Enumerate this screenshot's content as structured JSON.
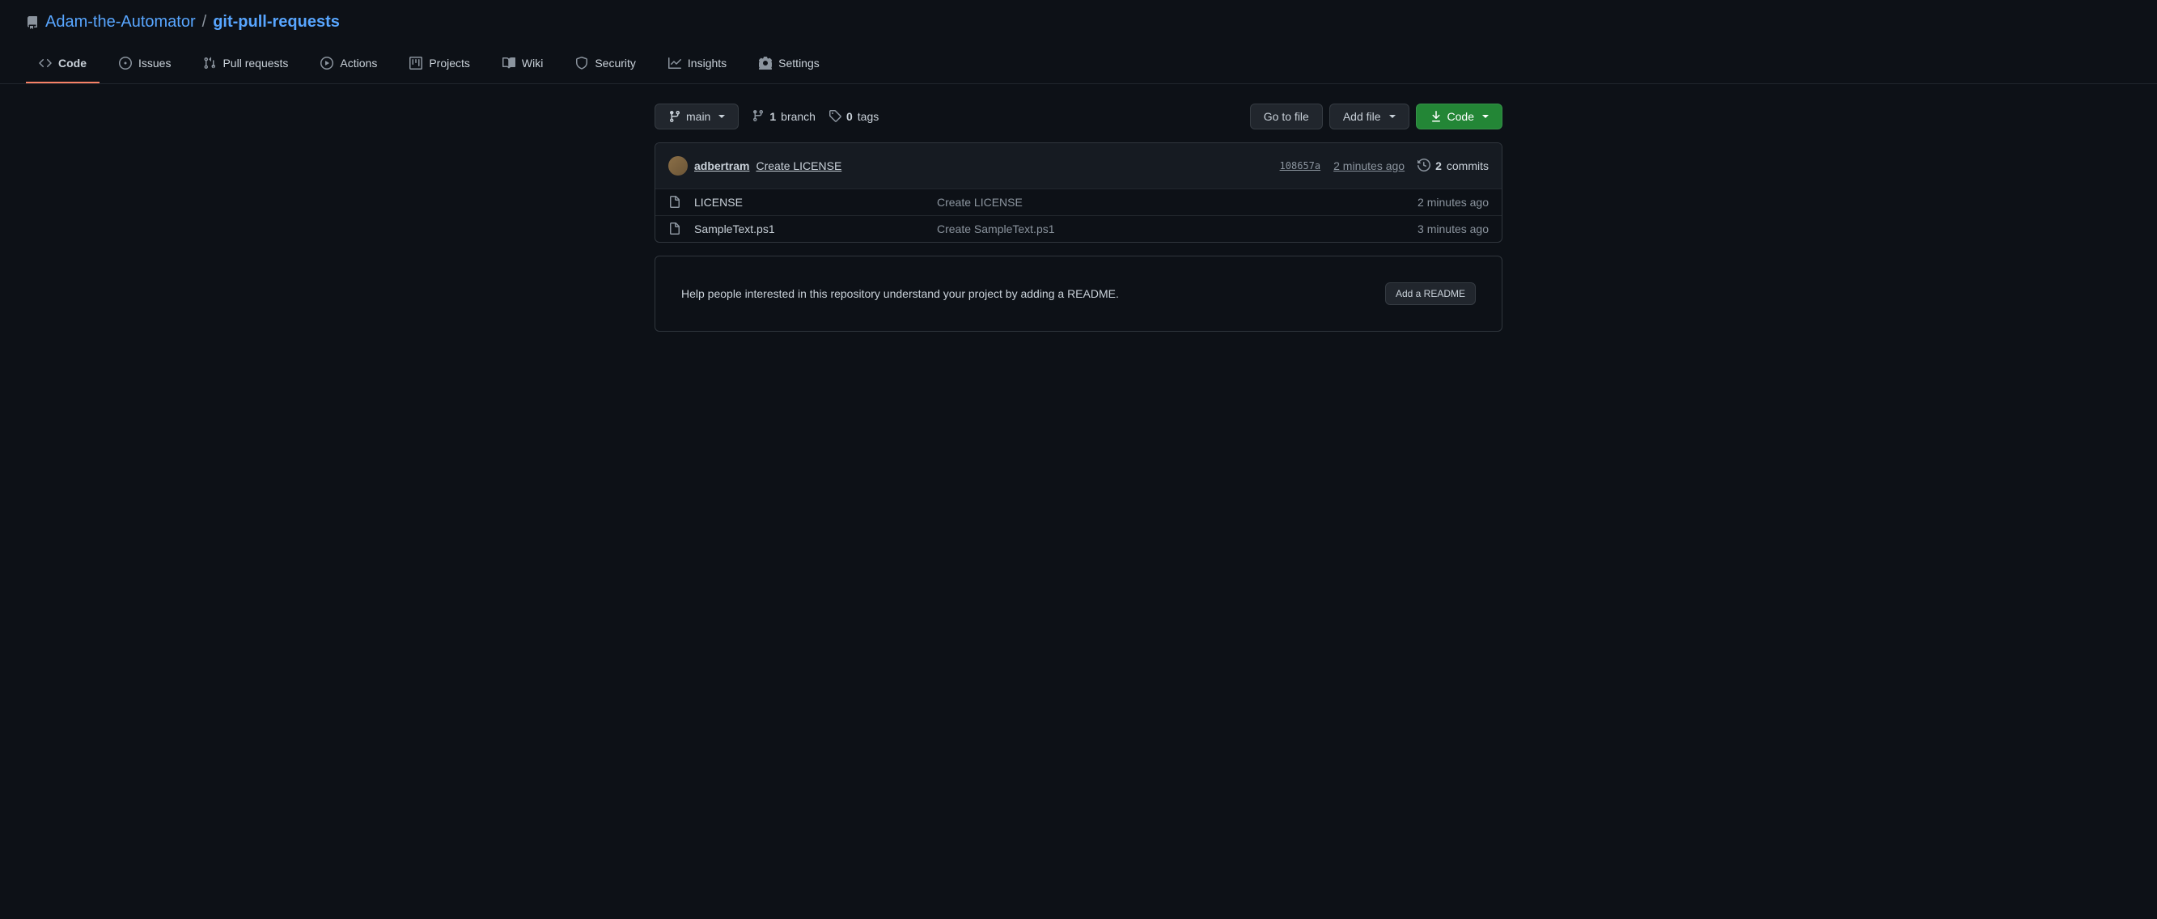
{
  "breadcrumb": {
    "owner": "Adam-the-Automator",
    "repo": "git-pull-requests"
  },
  "tabs": {
    "code": "Code",
    "issues": "Issues",
    "pull_requests": "Pull requests",
    "actions": "Actions",
    "projects": "Projects",
    "wiki": "Wiki",
    "security": "Security",
    "insights": "Insights",
    "settings": "Settings"
  },
  "toolbar": {
    "branch_name": "main",
    "branch_count": "1",
    "branch_label": "branch",
    "tag_count": "0",
    "tag_label": "tags",
    "go_to_file": "Go to file",
    "add_file": "Add file",
    "code_button": "Code"
  },
  "commit": {
    "author": "adbertram",
    "message": "Create LICENSE",
    "sha": "108657a",
    "time": "2 minutes ago",
    "count": "2",
    "count_label": "commits"
  },
  "files": [
    {
      "name": "LICENSE",
      "message": "Create LICENSE",
      "time": "2 minutes ago"
    },
    {
      "name": "SampleText.ps1",
      "message": "Create SampleText.ps1",
      "time": "3 minutes ago"
    }
  ],
  "readme": {
    "help_text": "Help people interested in this repository understand your project by adding a README.",
    "add_button": "Add a README"
  }
}
